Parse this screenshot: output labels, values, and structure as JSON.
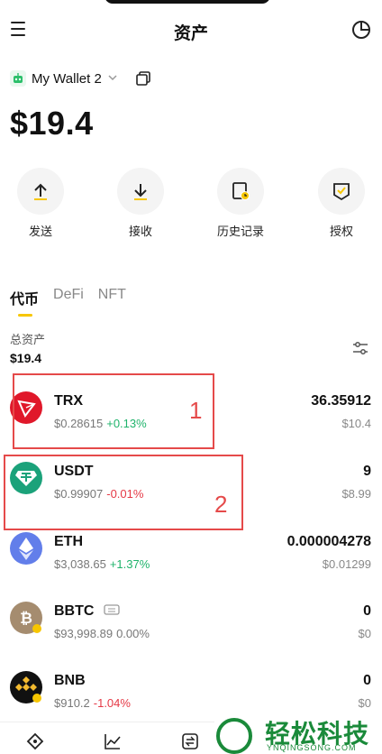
{
  "header": {
    "title": "资产"
  },
  "wallet": {
    "name": "My Wallet 2"
  },
  "balance": "$19.4",
  "actions": [
    {
      "label": "发送",
      "icon": "upload-arrow-icon"
    },
    {
      "label": "接收",
      "icon": "download-arrow-icon"
    },
    {
      "label": "历史记录",
      "icon": "history-icon"
    },
    {
      "label": "授权",
      "icon": "authorize-shield-icon"
    }
  ],
  "tabs": [
    "代币",
    "DeFi",
    "NFT"
  ],
  "active_tab": "代币",
  "total": {
    "label": "总资产",
    "value": "$19.4"
  },
  "tokens": [
    {
      "symbol": "TRX",
      "price": "$0.28615",
      "change": "+0.13%",
      "amount": "36.35912",
      "value": "$10.4",
      "color": "#e0182a"
    },
    {
      "symbol": "USDT",
      "price": "$0.99907",
      "change": "-0.01%",
      "amount": "9",
      "value": "$8.99",
      "color": "#1ba27a"
    },
    {
      "symbol": "ETH",
      "price": "$3,038.65",
      "change": "+1.37%",
      "amount": "0.000004278",
      "value": "$0.01299",
      "color": "#627eea"
    },
    {
      "symbol": "BBTC",
      "price": "$93,998.89",
      "change": "0.00%",
      "amount": "0",
      "value": "$0",
      "color": "#a58c6f"
    },
    {
      "symbol": "BNB",
      "price": "$910.2",
      "change": "-1.04%",
      "amount": "0",
      "value": "$0",
      "color": "#111111"
    }
  ],
  "annotations": [
    "1",
    "2"
  ],
  "watermark": {
    "text": "轻松科技",
    "sub": "YNQINGSONG.COM"
  },
  "colors": {
    "accent": "#f7c600",
    "up": "#1fb36b",
    "down": "#e53946",
    "annotation": "#e54a4a"
  }
}
